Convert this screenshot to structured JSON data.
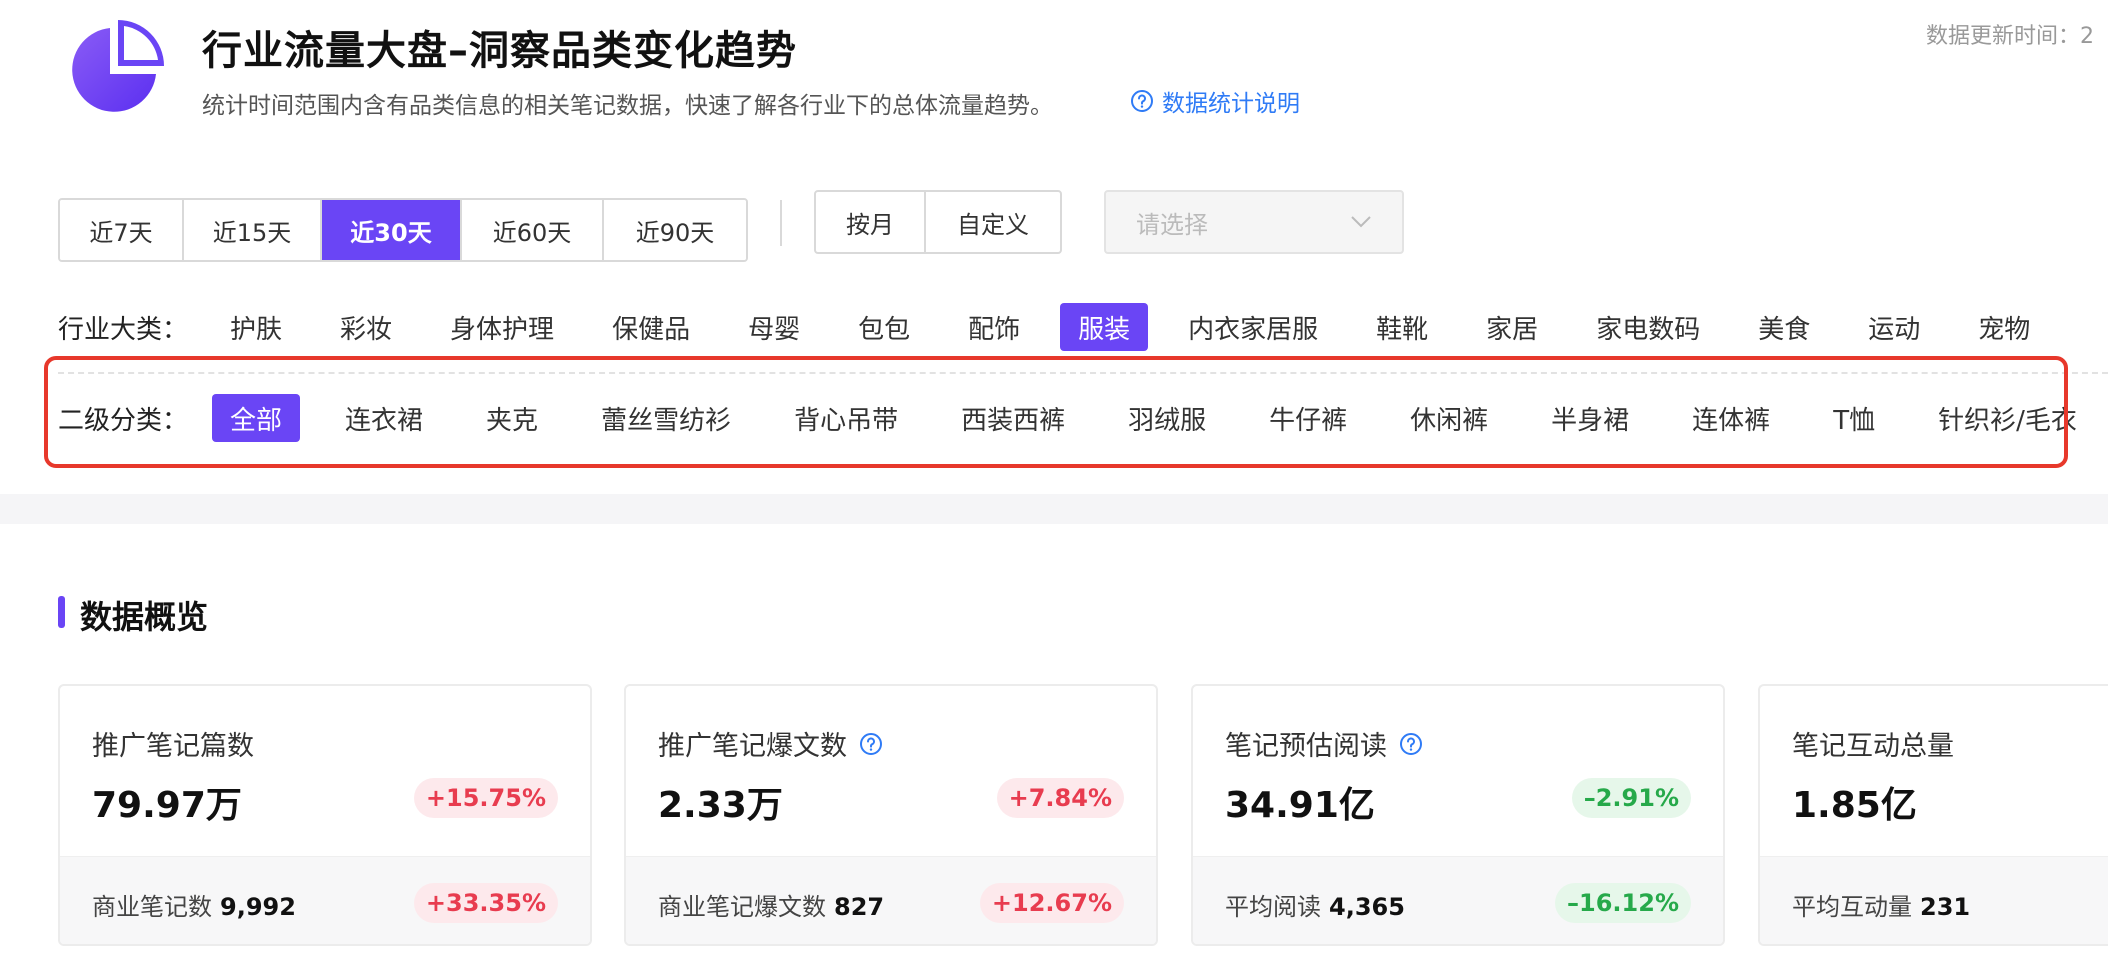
{
  "header": {
    "title": "行业流量大盘–洞察品类变化趋势",
    "subtitle": "统计时间范围内含有品类信息的相关笔记数据，快速了解各行业下的总体流量趋势。",
    "help_link": "数据统计说明",
    "update_time_label": "数据更新时间：2",
    "brand_color": "#6a45f5"
  },
  "time_range": {
    "options": [
      "近7天",
      "近15天",
      "近30天",
      "近60天",
      "近90天"
    ],
    "selected": "近30天"
  },
  "mode": {
    "options": [
      "按月",
      "自定义"
    ]
  },
  "select": {
    "placeholder": "请选择"
  },
  "industry": {
    "label": "行业大类：",
    "items": [
      "护肤",
      "彩妆",
      "身体护理",
      "保健品",
      "母婴",
      "包包",
      "配饰",
      "服装",
      "内衣家居服",
      "鞋靴",
      "家居",
      "家电数码",
      "美食",
      "运动",
      "宠物"
    ],
    "selected": "服装"
  },
  "subcategory": {
    "label": "二级分类：",
    "items": [
      "全部",
      "连衣裙",
      "夹克",
      "蕾丝雪纺衫",
      "背心吊带",
      "西装西裤",
      "羽绒服",
      "牛仔裤",
      "休闲裤",
      "半身裙",
      "连体裤",
      "T恤",
      "针织衫/毛衣"
    ],
    "selected": "全部"
  },
  "overview": {
    "title": "数据概览",
    "cards": [
      {
        "title": "推广笔记篇数",
        "value": "79.97万",
        "change": "+15.75%",
        "trend": "up",
        "sub_label": "商业笔记数",
        "sub_value": "9,992",
        "sub_change": "+33.35%",
        "sub_trend": "up"
      },
      {
        "title": "推广笔记爆文数",
        "has_help": true,
        "value": "2.33万",
        "change": "+7.84%",
        "trend": "up",
        "sub_label": "商业笔记爆文数",
        "sub_value": "827",
        "sub_change": "+12.67%",
        "sub_trend": "up"
      },
      {
        "title": "笔记预估阅读",
        "has_help": true,
        "value": "34.91亿",
        "change": "–2.91%",
        "trend": "down",
        "sub_label": "平均阅读",
        "sub_value": "4,365",
        "sub_change": "–16.12%",
        "sub_trend": "down"
      },
      {
        "title": "笔记互动总量",
        "value": "1.85亿",
        "sub_label": "平均互动量",
        "sub_value": "231"
      }
    ]
  }
}
